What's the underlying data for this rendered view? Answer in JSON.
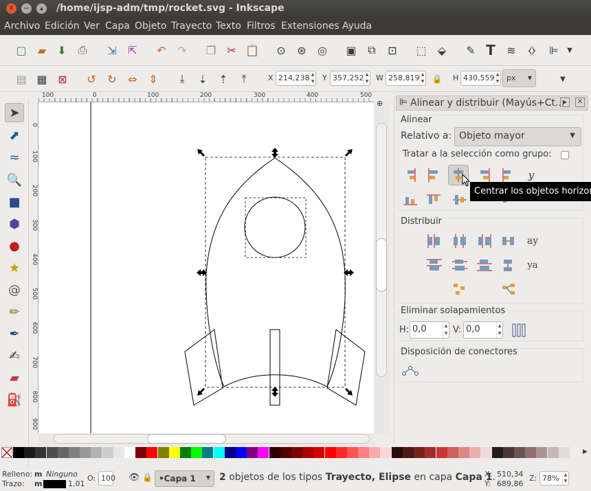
{
  "window": {
    "title": "/home/ijsp-adm/tmp/rocket.svg - Inkscape"
  },
  "menu": [
    "Archivo",
    "Edición",
    "Ver",
    "Capa",
    "Objeto",
    "Trayecto",
    "Texto",
    "Filtros",
    "Extensiones",
    "Ayuda"
  ],
  "toolbar2": {
    "x_label": "X",
    "x_value": "214,238",
    "y_label": "Y",
    "y_value": "357,252",
    "w_label": "W",
    "w_value": "258,819",
    "h_label": "H",
    "h_value": "430,559",
    "unit": "px"
  },
  "ruler": {
    "h_ticks": [
      "100",
      "0",
      "100",
      "200",
      "300",
      "400",
      "500"
    ],
    "v_ticks": [
      "0",
      "100",
      "200",
      "300",
      "400",
      "500",
      "600",
      "700",
      "800",
      "900"
    ]
  },
  "dock": {
    "title": "Alinear y distribuir (Mayús+Ct...",
    "align_title": "Alinear",
    "relative_label": "Relativo a:",
    "relative_value": "Objeto mayor",
    "group_label": "Tratar a la selección como grupo:",
    "distribute_title": "Distribuir",
    "remove_overlap_title": "Eliminar solapamientos",
    "h_label": "H:",
    "h_value": "0,0",
    "v_label": "V:",
    "v_value": "0,0",
    "connectors_title": "Disposición de conectores",
    "tooltip": "Centrar los objetos horizontalmente"
  },
  "status": {
    "fill_label": "Relleno:",
    "fill_m": "m",
    "fill_value": "Ninguno",
    "stroke_label": "Trazo:",
    "stroke_m": "m",
    "stroke_width": "1,01",
    "opacity_label": "O:",
    "opacity_value": "100",
    "layer": "•Capa 1",
    "message_count": "2",
    "message_1": " objetos de los tipos ",
    "message_types": "Trayecto, Elipse",
    "message_2": " en capa ",
    "message_layer": "Capa 1",
    "message_end": ".",
    "x_label": "X:",
    "x_value": "510,34",
    "y_label": "Y:",
    "y_value": "689,86",
    "zoom_label": "Z:",
    "zoom_value": "78%"
  },
  "palette": [
    "#000000",
    "#1a1a1a",
    "#333333",
    "#4d4d4d",
    "#666666",
    "#808080",
    "#999999",
    "#b3b3b3",
    "#cccccc",
    "#e6e6e6",
    "#ffffff",
    "#800000",
    "#ff0000",
    "#808000",
    "#ffff00",
    "#008000",
    "#00ff00",
    "#008080",
    "#00ffff",
    "#000080",
    "#0000ff",
    "#800080",
    "#ff00ff",
    "#2b0000",
    "#550000",
    "#800000",
    "#aa0000",
    "#d40000",
    "#ff0000",
    "#ff2a2a",
    "#ff5555",
    "#ff8080",
    "#ffaaaa",
    "#ffd5d5",
    "#280b0b",
    "#501616",
    "#782121",
    "#a02c2c",
    "#c83737",
    "#d35f5f",
    "#de8787",
    "#e9afaf",
    "#f4d7d7",
    "#241c1c",
    "#483737",
    "#6c5353",
    "#916f6f",
    "#ac9393",
    "#c8b7b7",
    "#e3dbdb"
  ]
}
